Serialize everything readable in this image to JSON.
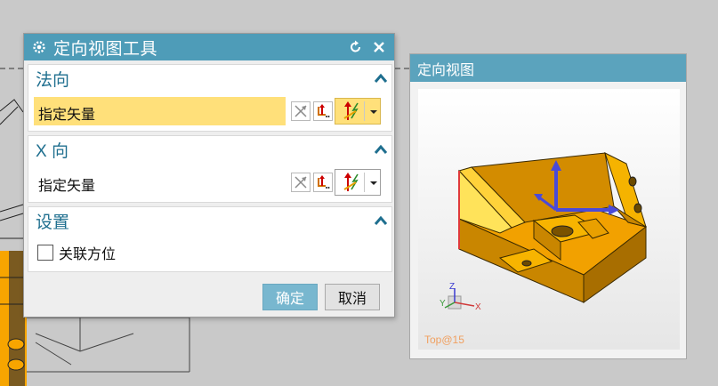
{
  "dialog": {
    "title": "定向视图工具",
    "sections": {
      "normal": {
        "title": "法向",
        "vector_label": "指定矢量"
      },
      "x_dir": {
        "title": "X 向",
        "vector_label": "指定矢量"
      },
      "settings": {
        "title": "设置",
        "checkbox_label": "关联方位",
        "checked": false
      }
    },
    "ok_label": "确定",
    "cancel_label": "取消"
  },
  "preview": {
    "title": "定向视图",
    "view_name": "Top@15",
    "triad": {
      "x": "X",
      "y": "Y",
      "z": "Z"
    }
  },
  "colors": {
    "titlebar": "#4e9cb8",
    "section_title": "#1f6f8f",
    "active_field": "#ffe07a",
    "ok_button": "#78b7cf",
    "part": "#f5a800"
  }
}
